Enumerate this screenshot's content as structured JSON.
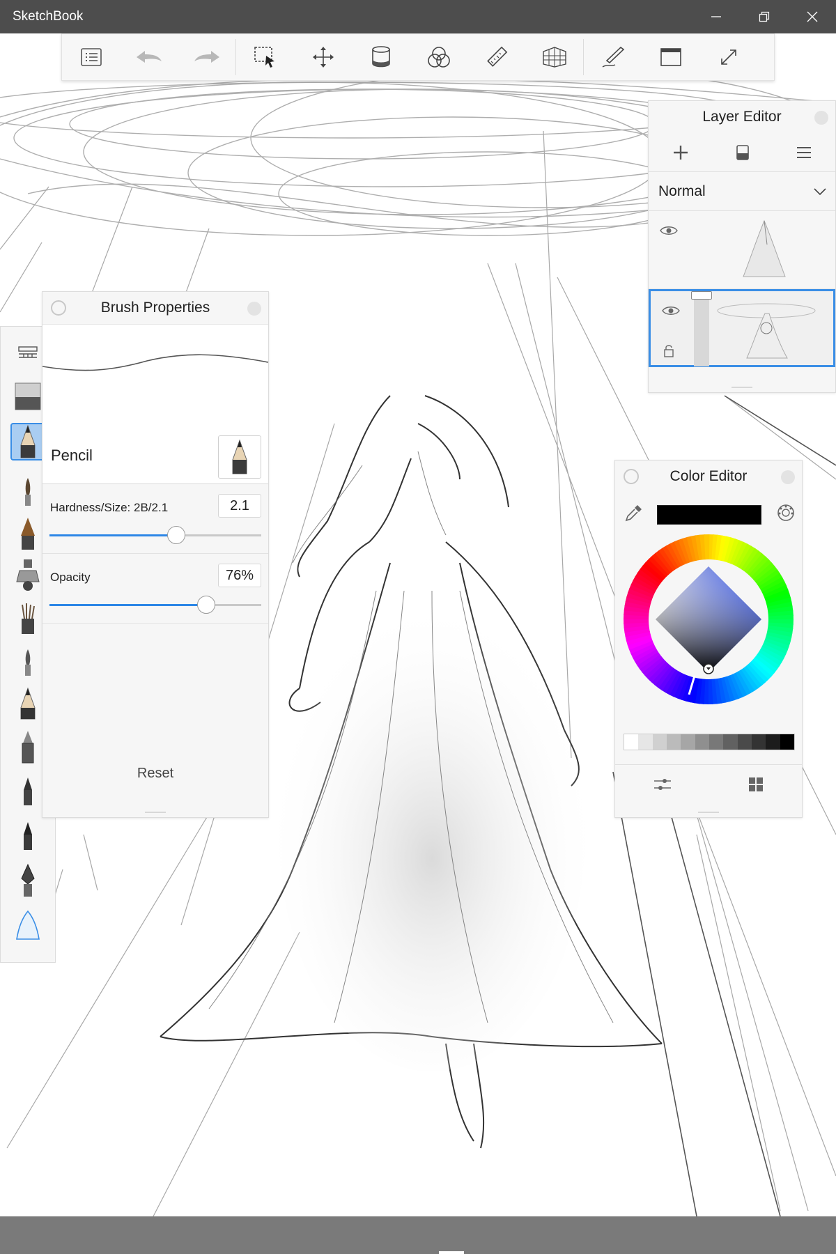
{
  "window": {
    "title": "SketchBook"
  },
  "toolbar": {
    "items": [
      "lagoon-menu-icon",
      "undo-icon",
      "redo-icon",
      "selection-icon",
      "transform-icon",
      "fill-icon",
      "symmetry-icon",
      "ruler-icon",
      "perspective-icon",
      "brush-icon",
      "canvas-window-icon",
      "fullscreen-icon"
    ]
  },
  "layer_editor": {
    "title": "Layer Editor",
    "blend_mode": "Normal",
    "layers": [
      {
        "visible": true,
        "selected": false
      },
      {
        "visible": true,
        "selected": true,
        "opacity": 1.0
      }
    ]
  },
  "brush_properties": {
    "title": "Brush Properties",
    "brush_name": "Pencil",
    "hardness_label": "Hardness/Size: 2B/2.1",
    "hardness_value": "2.1",
    "hardness_fraction": 0.6,
    "opacity_label": "Opacity",
    "opacity_value": "76%",
    "opacity_fraction": 0.74,
    "reset_label": "Reset"
  },
  "brush_palette": {
    "items": [
      "brush-library-icon",
      "eraser-brush-icon",
      "pencil-brush-icon",
      "paint-brush-icon",
      "flat-brush-icon",
      "airbrush-icon",
      "bristle-brush-icon",
      "round-brush-icon",
      "graphite-pencil-icon",
      "technical-pen-icon",
      "fine-marker-icon",
      "chisel-marker-icon",
      "fountain-pen-icon",
      "smudge-brush-icon"
    ],
    "selected_index": 2
  },
  "color_editor": {
    "title": "Color Editor",
    "current_color": "#000000",
    "grays": [
      "#ffffff",
      "#e6e6e6",
      "#d0d0d0",
      "#bbbbbb",
      "#a6a6a6",
      "#8f8f8f",
      "#787878",
      "#616161",
      "#4a4a4a",
      "#333333",
      "#1c1c1c",
      "#000000"
    ]
  },
  "colors": {
    "accent": "#2c86e6",
    "titlebar": "#4d4d4d",
    "selection": "#3a8ee6"
  }
}
